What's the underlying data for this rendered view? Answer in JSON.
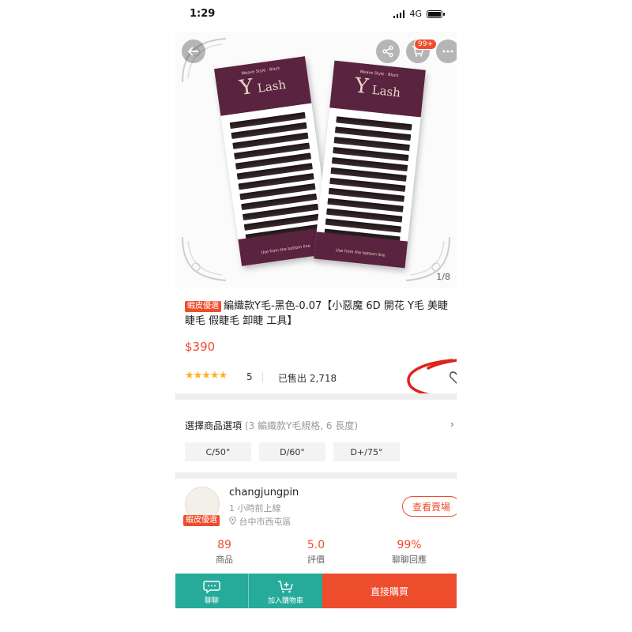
{
  "status_bar": {
    "time": "1:29",
    "network": "4G"
  },
  "hero": {
    "cart_badge": "99+",
    "pager": "1/8",
    "brand_y": "Y",
    "brand_lash": "Lash",
    "brand_small": "Weave Style · Black",
    "card_foot": "Use from the bottom line"
  },
  "product": {
    "tag": "蝦皮優選",
    "title": "編織款Y毛-黑色-0.07【小惡魔 6D 開花 Y毛 美睫 睫毛 假睫毛 卸睫 工具】",
    "price": "$390",
    "stars": "★★★★★",
    "rating_count": "5",
    "sold": "已售出 2,718"
  },
  "options": {
    "title": "選擇商品選項",
    "hint": "(3 編織款Y毛規格, 6 長度)",
    "chips": [
      "C/50°",
      "D/60°",
      "D+/75°"
    ]
  },
  "shop": {
    "name": "changjungpin",
    "online": "1 小時前上線",
    "location": "台中市西屯區",
    "tag": "蝦皮優選",
    "view_button": "查看賣場",
    "stats": [
      {
        "value": "89",
        "label": "商品"
      },
      {
        "value": "5.0",
        "label": "評價"
      },
      {
        "value": "99%",
        "label": "聊聊回應"
      }
    ]
  },
  "bottom_bar": {
    "chat": "聊聊",
    "add_cart": "加入購物車",
    "buy_now": "直接購買"
  },
  "colors": {
    "accent": "#ee4d2d",
    "teal": "#26aa99",
    "annotation": "#e0231c"
  }
}
